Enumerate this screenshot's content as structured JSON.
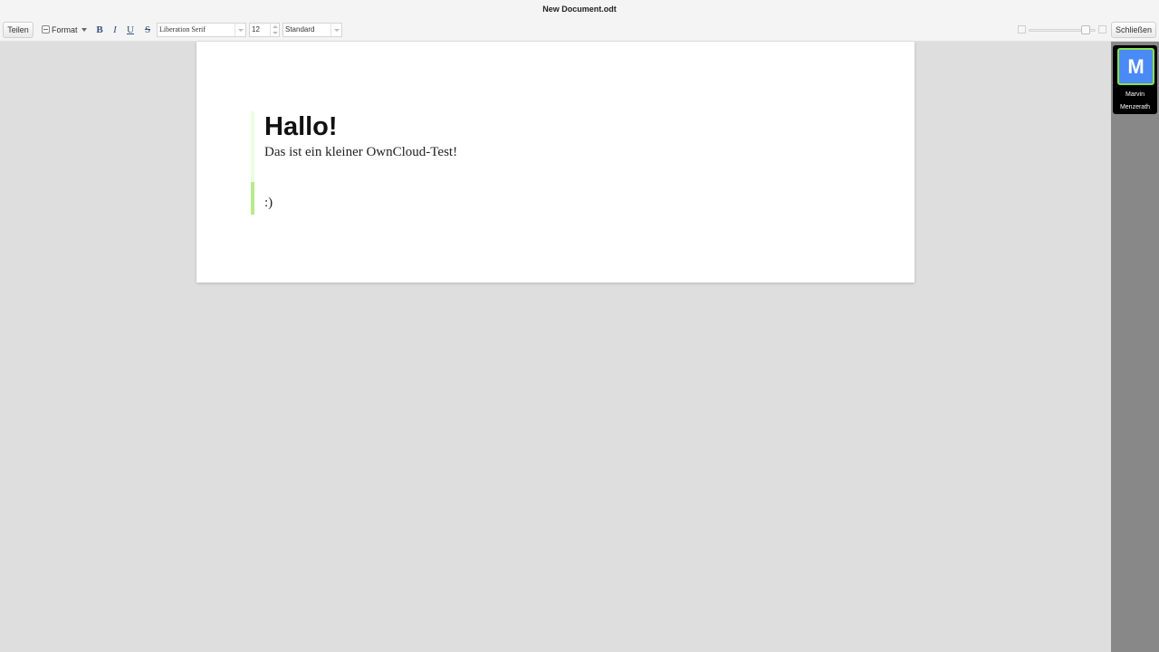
{
  "window": {
    "title": "New Document.odt"
  },
  "toolbar": {
    "share_label": "Teilen",
    "format_label": "Format",
    "bold_label": "B",
    "italic_label": "I",
    "underline_label": "U",
    "strikethrough_label": "S",
    "font_family": "Liberation Serif",
    "font_size": "12",
    "paragraph_style": "Standard",
    "zoom_level": 0.9,
    "close_label": "Schließen"
  },
  "document": {
    "heading": "Hallo!",
    "paragraph": "Das ist ein kleiner OwnCloud-Test!",
    "last_line": ":)"
  },
  "sidebar": {
    "user": {
      "initial": "M",
      "first_name": "Marvin",
      "last_name": "Menzerath",
      "avatar_color": "#4a8af4",
      "border_color": "#8ee04a"
    }
  },
  "colors": {
    "workspace_background": "#dedede",
    "cursor_highlight": "#b9ea8c",
    "sidebar_background": "#888888"
  }
}
